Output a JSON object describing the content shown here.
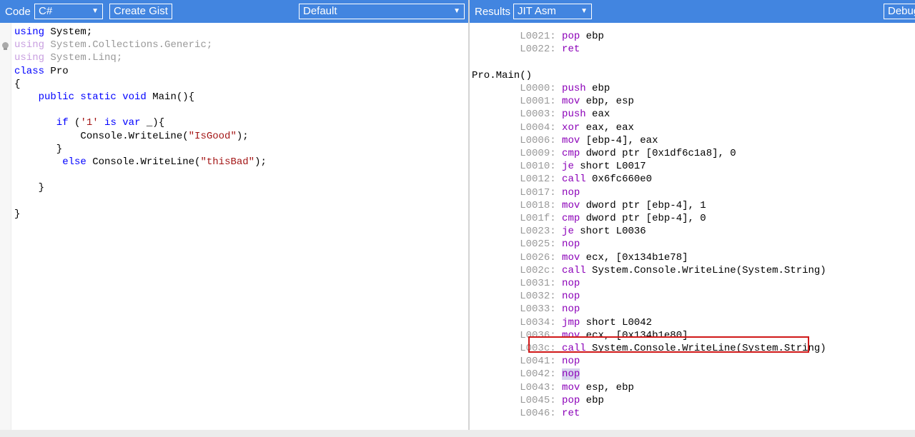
{
  "code_bar": {
    "label": "Code",
    "language": "C#",
    "create_gist": "Create Gist",
    "mode": "Default"
  },
  "results_bar": {
    "label": "Results",
    "output": "JIT Asm",
    "debug": "Debug"
  },
  "code": {
    "line1a": "using",
    "line1b": " System;",
    "line2a": "using",
    "line2b": " System.Collections.Generic;",
    "line3a": "using",
    "line3b": " System.Linq;",
    "line4a": "class",
    "line4b": " Pro",
    "line5": "{",
    "line6a": "    public static void",
    "line6b": " Main(){",
    "line8a": "       if",
    "line8b": " (",
    "line8c": "'1'",
    "line8d": " is",
    "line8e": " var",
    "line8f": " _){",
    "line9a": "           Console.WriteLine(",
    "line9b": "\"IsGood\"",
    "line9c": ");",
    "line10": "       }",
    "line11a": "        else",
    "line11b": " Console.WriteLine(",
    "line11c": "\"thisBad\"",
    "line11d": ");",
    "line13": "    }",
    "line15": "}"
  },
  "asm": {
    "top": [
      {
        "label": "L0021:",
        "op": "pop",
        "args": " ebp"
      },
      {
        "label": "L0022:",
        "op": "ret",
        "args": ""
      }
    ],
    "method": "Pro.Main()",
    "lines": [
      {
        "label": "L0000:",
        "op": "push",
        "args": " ebp"
      },
      {
        "label": "L0001:",
        "op": "mov",
        "args": " ebp, esp"
      },
      {
        "label": "L0003:",
        "op": "push",
        "args": " eax"
      },
      {
        "label": "L0004:",
        "op": "xor",
        "args": " eax, eax"
      },
      {
        "label": "L0006:",
        "op": "mov",
        "args": " [ebp-4], eax"
      },
      {
        "label": "L0009:",
        "op": "cmp",
        "args": " dword ptr [0x1df6c1a8], 0"
      },
      {
        "label": "L0010:",
        "op": "je",
        "args": " short L0017"
      },
      {
        "label": "L0012:",
        "op": "call",
        "args": " 0x6fc660e0"
      },
      {
        "label": "L0017:",
        "op": "nop",
        "args": ""
      },
      {
        "label": "L0018:",
        "op": "mov",
        "args": " dword ptr [ebp-4], 1"
      },
      {
        "label": "L001f:",
        "op": "cmp",
        "args": " dword ptr [ebp-4], 0"
      },
      {
        "label": "L0023:",
        "op": "je",
        "args": " short L0036"
      },
      {
        "label": "L0025:",
        "op": "nop",
        "args": ""
      },
      {
        "label": "L0026:",
        "op": "mov",
        "args": " ecx, [0x134b1e78]"
      },
      {
        "label": "L002c:",
        "op": "call",
        "args": " System.Console.WriteLine(System.String)"
      },
      {
        "label": "L0031:",
        "op": "nop",
        "args": ""
      },
      {
        "label": "L0032:",
        "op": "nop",
        "args": ""
      },
      {
        "label": "L0033:",
        "op": "nop",
        "args": ""
      },
      {
        "label": "L0034:",
        "op": "jmp",
        "args": " short L0042"
      },
      {
        "label": "L0036:",
        "op": "mov",
        "args": " ecx, [0x134b1e80]"
      },
      {
        "label": "L003c:",
        "op": "call",
        "args": " System.Console.WriteLine(System.String)"
      },
      {
        "label": "L0041:",
        "op": "nop",
        "args": ""
      },
      {
        "label": "L0042:",
        "op": "nop",
        "args": ""
      },
      {
        "label": "L0043:",
        "op": "mov",
        "args": " esp, ebp"
      },
      {
        "label": "L0045:",
        "op": "pop",
        "args": " ebp"
      },
      {
        "label": "L0046:",
        "op": "ret",
        "args": ""
      }
    ]
  },
  "colors": {
    "toolbar": "#4285e0",
    "highlight_box": "#d01818",
    "selected_nop": "#d6d2ee"
  }
}
